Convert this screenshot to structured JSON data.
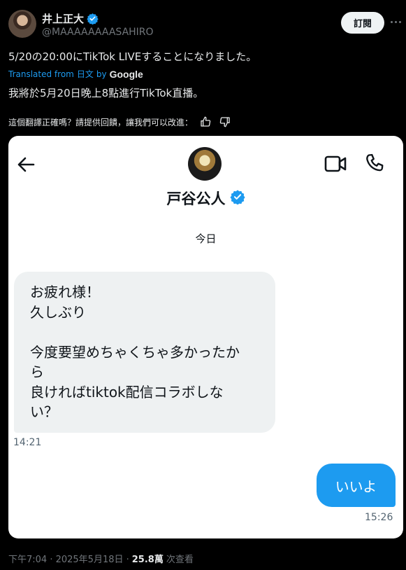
{
  "header": {
    "display_name": "井上正大",
    "handle": "@MAAAAAAAASAHIRO",
    "subscribe_label": "訂閱"
  },
  "tweet": {
    "text": "5/20の20:00にTikTok LIVEすることになりました。",
    "translated_from_prefix": "Translated from",
    "translated_language": "日文",
    "translated_by": "by",
    "google_label": "Google",
    "translation": "我將於5月20日晚上8點進行TikTok直播。",
    "feedback_prompt": "這個翻譯正確嗎？請提供回饋，讓我們可以改進："
  },
  "dm_card": {
    "contact_name": "戸谷公人",
    "day_label": "今日",
    "incoming_message": "お疲れ様！\n久しぶり\n\n今度要望めちゃくちゃ多かったか\nら\n良ければtiktok配信コラボしな\nい？",
    "incoming_time": "14:21",
    "outgoing_message": "いいよ",
    "outgoing_time": "15:26"
  },
  "footer": {
    "timestamp": "下午7:04 · 2025年5月18日 · ",
    "views_count": "25.8萬",
    "views_label": "次查看"
  },
  "colors": {
    "accent": "#1d9bf0",
    "background": "#000000",
    "card": "#ffffff"
  }
}
